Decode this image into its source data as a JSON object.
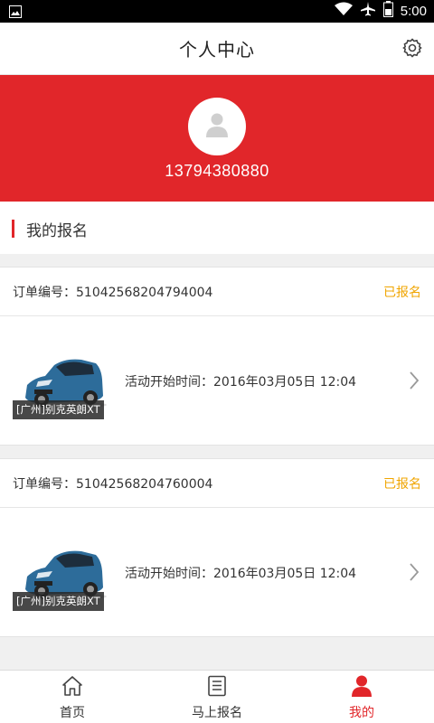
{
  "status_bar": {
    "time": "5:00",
    "icons": [
      "image-icon",
      "wifi-icon",
      "airplane-icon",
      "battery-icon"
    ]
  },
  "header": {
    "title": "个人中心",
    "settings_icon": "gear-icon"
  },
  "profile": {
    "phone": "13794380880",
    "avatar_icon": "user-icon"
  },
  "section": {
    "title": "我的报名"
  },
  "orders": [
    {
      "order_no_label": "订单编号：51042568204794004",
      "status": "已报名",
      "car_tag": "[广州]别克英朗XT",
      "activity_time": "活动开始时间：2016年03月05日 12:04"
    },
    {
      "order_no_label": "订单编号：51042568204760004",
      "status": "已报名",
      "car_tag": "[广州]别克英朗XT",
      "activity_time": "活动开始时间：2016年03月05日 12:04"
    }
  ],
  "tabbar": {
    "items": [
      {
        "label": "首页",
        "icon": "home-icon"
      },
      {
        "label": "马上报名",
        "icon": "list-icon"
      },
      {
        "label": "我的",
        "icon": "user-icon"
      }
    ],
    "active_index": 2
  },
  "colors": {
    "brand": "#e1262a",
    "status": "#f0a500"
  }
}
